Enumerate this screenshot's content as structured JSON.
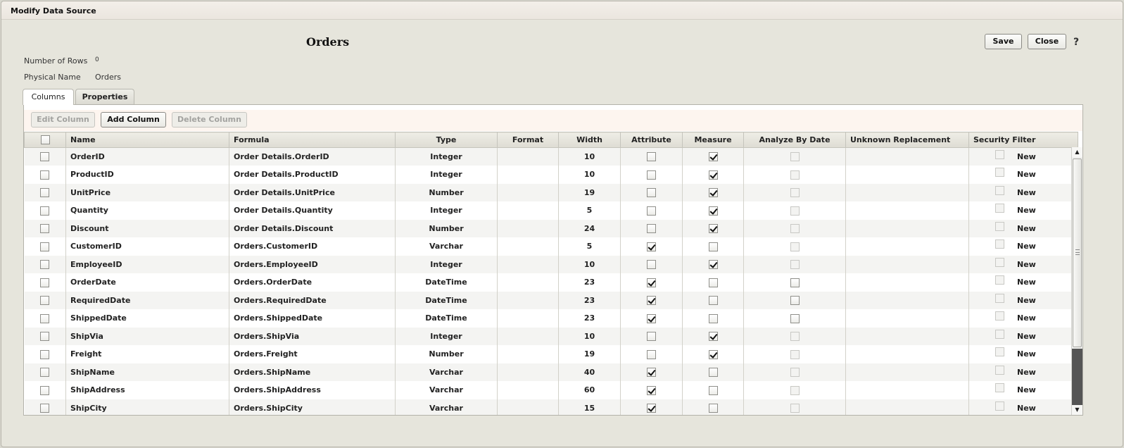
{
  "window": {
    "title": "Modify Data Source"
  },
  "page": {
    "heading": "Orders"
  },
  "info": {
    "rows_label": "Number of Rows",
    "rows_value": "0",
    "physical_label": "Physical Name",
    "physical_value": "Orders"
  },
  "actions": {
    "save": "Save",
    "close": "Close",
    "help": "?"
  },
  "tabs": {
    "columns": "Columns",
    "properties": "Properties"
  },
  "toolbar": {
    "edit": "Edit Column",
    "add": "Add Column",
    "delete": "Delete Column"
  },
  "headers": {
    "name": "Name",
    "formula": "Formula",
    "type": "Type",
    "format": "Format",
    "width": "Width",
    "attribute": "Attribute",
    "measure": "Measure",
    "analyze": "Analyze By Date",
    "unknown": "Unknown Replacement",
    "security": "Security Filter"
  },
  "rows": [
    {
      "name": "OrderID",
      "formula": "Order Details.OrderID",
      "type": "Integer",
      "format": "",
      "width": "10",
      "attribute": false,
      "measure": true,
      "analyze_enabled": false,
      "unknown": "",
      "security_link": "New"
    },
    {
      "name": "ProductID",
      "formula": "Order Details.ProductID",
      "type": "Integer",
      "format": "",
      "width": "10",
      "attribute": false,
      "measure": true,
      "analyze_enabled": false,
      "unknown": "",
      "security_link": "New"
    },
    {
      "name": "UnitPrice",
      "formula": "Order Details.UnitPrice",
      "type": "Number",
      "format": "",
      "width": "19",
      "attribute": false,
      "measure": true,
      "analyze_enabled": false,
      "unknown": "",
      "security_link": "New"
    },
    {
      "name": "Quantity",
      "formula": "Order Details.Quantity",
      "type": "Integer",
      "format": "",
      "width": "5",
      "attribute": false,
      "measure": true,
      "analyze_enabled": false,
      "unknown": "",
      "security_link": "New"
    },
    {
      "name": "Discount",
      "formula": "Order Details.Discount",
      "type": "Number",
      "format": "",
      "width": "24",
      "attribute": false,
      "measure": true,
      "analyze_enabled": false,
      "unknown": "",
      "security_link": "New"
    },
    {
      "name": "CustomerID",
      "formula": "Orders.CustomerID",
      "type": "Varchar",
      "format": "",
      "width": "5",
      "attribute": true,
      "measure": false,
      "analyze_enabled": false,
      "unknown": "",
      "security_link": "New"
    },
    {
      "name": "EmployeeID",
      "formula": "Orders.EmployeeID",
      "type": "Integer",
      "format": "",
      "width": "10",
      "attribute": false,
      "measure": true,
      "analyze_enabled": false,
      "unknown": "",
      "security_link": "New"
    },
    {
      "name": "OrderDate",
      "formula": "Orders.OrderDate",
      "type": "DateTime",
      "format": "",
      "width": "23",
      "attribute": true,
      "measure": false,
      "analyze_enabled": true,
      "unknown": "",
      "security_link": "New"
    },
    {
      "name": "RequiredDate",
      "formula": "Orders.RequiredDate",
      "type": "DateTime",
      "format": "",
      "width": "23",
      "attribute": true,
      "measure": false,
      "analyze_enabled": true,
      "unknown": "",
      "security_link": "New"
    },
    {
      "name": "ShippedDate",
      "formula": "Orders.ShippedDate",
      "type": "DateTime",
      "format": "",
      "width": "23",
      "attribute": true,
      "measure": false,
      "analyze_enabled": true,
      "unknown": "",
      "security_link": "New"
    },
    {
      "name": "ShipVia",
      "formula": "Orders.ShipVia",
      "type": "Integer",
      "format": "",
      "width": "10",
      "attribute": false,
      "measure": true,
      "analyze_enabled": false,
      "unknown": "",
      "security_link": "New"
    },
    {
      "name": "Freight",
      "formula": "Orders.Freight",
      "type": "Number",
      "format": "",
      "width": "19",
      "attribute": false,
      "measure": true,
      "analyze_enabled": false,
      "unknown": "",
      "security_link": "New"
    },
    {
      "name": "ShipName",
      "formula": "Orders.ShipName",
      "type": "Varchar",
      "format": "",
      "width": "40",
      "attribute": true,
      "measure": false,
      "analyze_enabled": false,
      "unknown": "",
      "security_link": "New"
    },
    {
      "name": "ShipAddress",
      "formula": "Orders.ShipAddress",
      "type": "Varchar",
      "format": "",
      "width": "60",
      "attribute": true,
      "measure": false,
      "analyze_enabled": false,
      "unknown": "",
      "security_link": "New"
    },
    {
      "name": "ShipCity",
      "formula": "Orders.ShipCity",
      "type": "Varchar",
      "format": "",
      "width": "15",
      "attribute": true,
      "measure": false,
      "analyze_enabled": false,
      "unknown": "",
      "security_link": "New"
    }
  ]
}
